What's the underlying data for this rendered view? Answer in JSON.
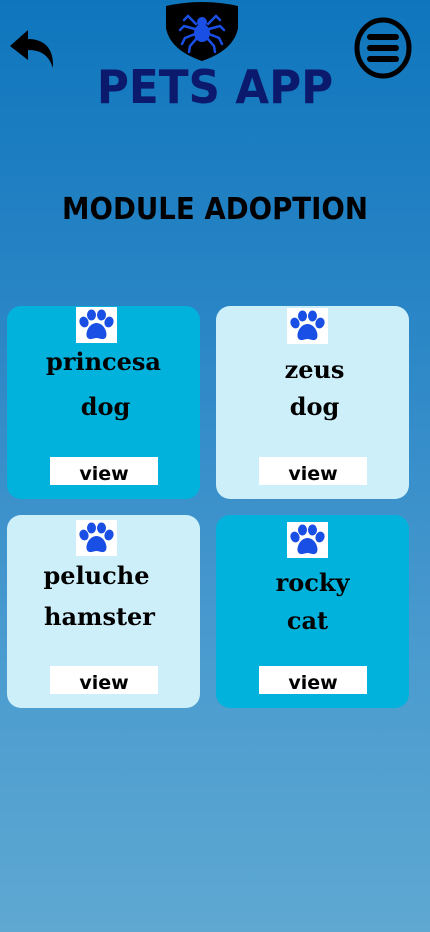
{
  "header": {
    "title": "PETS APP",
    "back_icon": "undo-arrow-icon",
    "menu_icon": "hamburger-menu-icon",
    "logo_icon": "spider-shield-icon"
  },
  "section_title": "MODULE ADOPTION",
  "colors": {
    "title": "#0c1a6e",
    "card_dark": "#00b2dc",
    "card_light": "#cdeff9",
    "paw": "#1a4fe6"
  },
  "pets": [
    {
      "name": "princesa",
      "type": "dog",
      "button": "view",
      "paw_icon": "paw-icon"
    },
    {
      "name": "zeus",
      "type": "dog",
      "button": "view",
      "paw_icon": "paw-icon"
    },
    {
      "name": "peluche",
      "type": "hamster",
      "button": "view",
      "paw_icon": "paw-icon"
    },
    {
      "name": "rocky",
      "type": "cat",
      "button": "view",
      "paw_icon": "paw-icon"
    }
  ]
}
